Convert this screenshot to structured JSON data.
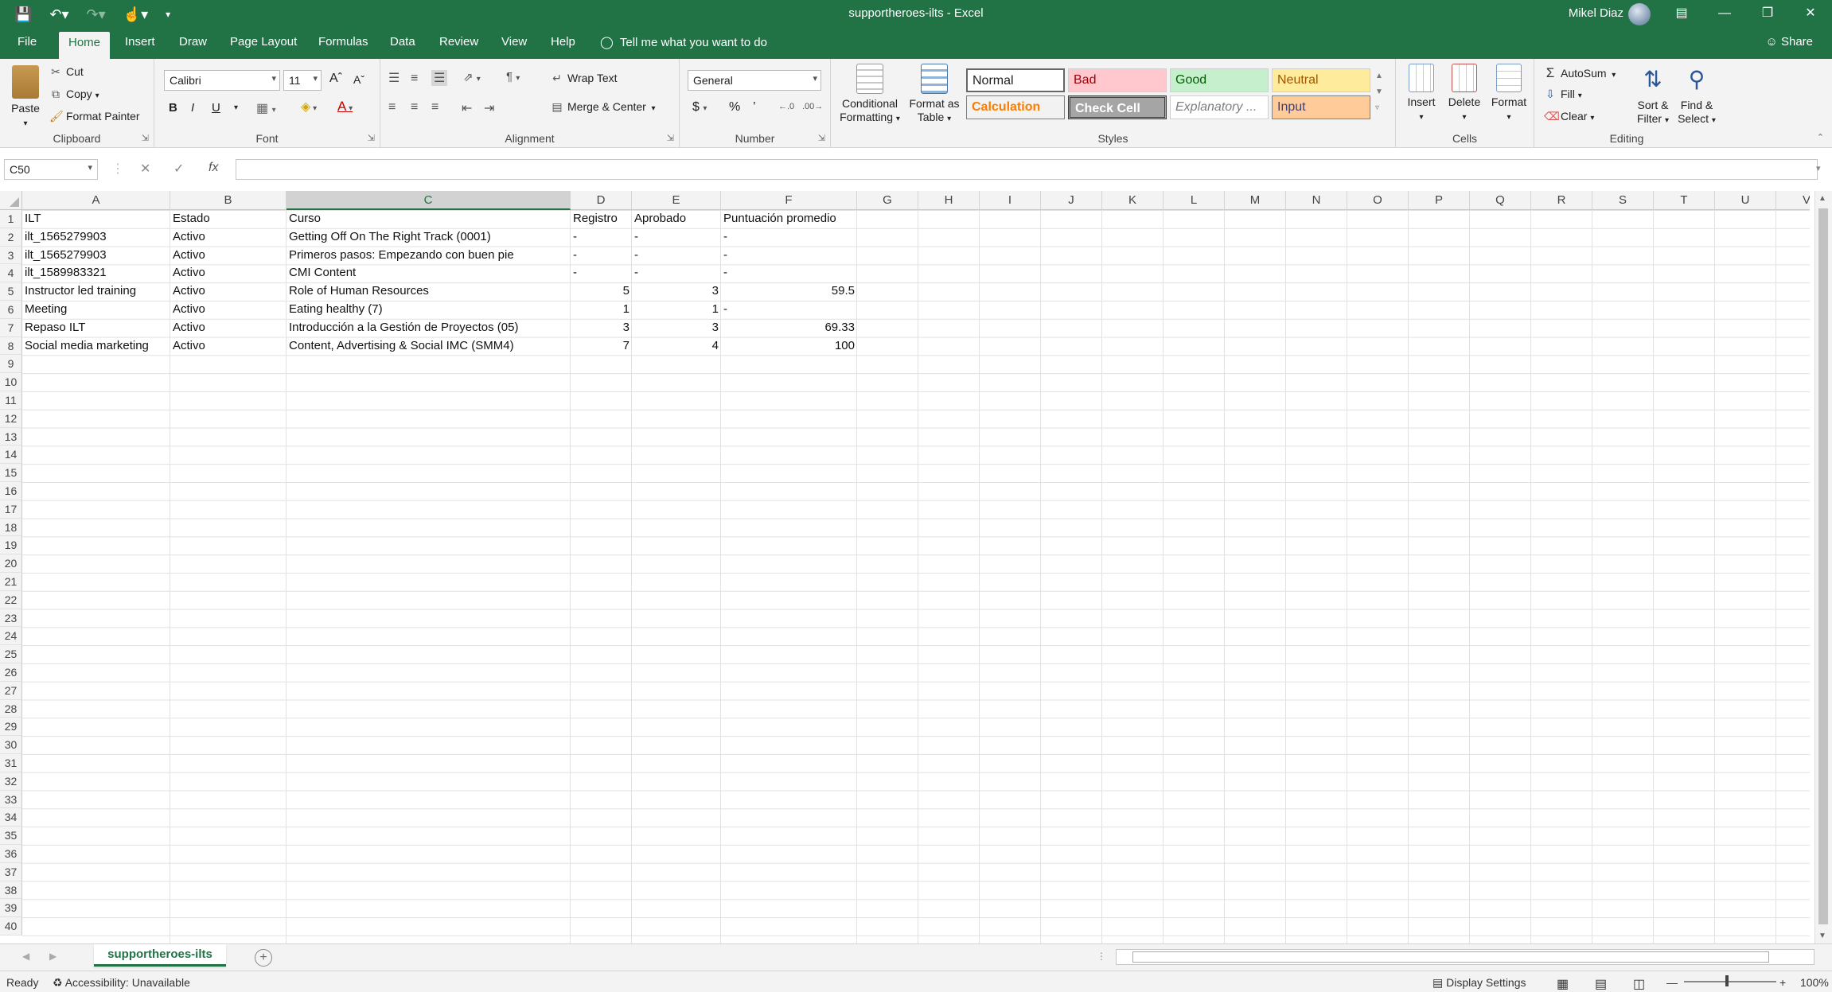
{
  "window": {
    "title": "supportheroes-ilts  -  Excel",
    "user": "Mikel Diaz"
  },
  "tabs": [
    "File",
    "Home",
    "Insert",
    "Draw",
    "Page Layout",
    "Formulas",
    "Data",
    "Review",
    "View",
    "Help"
  ],
  "tell_me": "Tell me what you want to do",
  "share": "Share",
  "ribbon": {
    "clipboard": {
      "label": "Clipboard",
      "paste": "Paste",
      "cut": "Cut",
      "copy": "Copy",
      "format_painter": "Format Painter"
    },
    "font": {
      "label": "Font",
      "name": "Calibri",
      "size": "11",
      "bold": "B",
      "italic": "I",
      "underline": "U"
    },
    "alignment": {
      "label": "Alignment",
      "wrap_text": "Wrap Text",
      "merge_center": "Merge & Center"
    },
    "number": {
      "label": "Number",
      "format": "General",
      "currency": "$",
      "percent": "%",
      "comma": "’"
    },
    "styles": {
      "label": "Styles",
      "conditional": [
        "Conditional",
        "Formatting"
      ],
      "format_table": [
        "Format as",
        "Table"
      ],
      "normal": "Normal",
      "bad": "Bad",
      "good": "Good",
      "neutral": "Neutral",
      "calculation": "Calculation",
      "check_cell": "Check Cell",
      "explanatory": "Explanatory ...",
      "input": "Input"
    },
    "cells": {
      "label": "Cells",
      "insert": "Insert",
      "delete": "Delete",
      "format": "Format"
    },
    "editing": {
      "label": "Editing",
      "autosum": "AutoSum",
      "fill": "Fill",
      "clear": "Clear",
      "sort": [
        "Sort &",
        "Filter"
      ],
      "find": [
        "Find &",
        "Select"
      ]
    }
  },
  "formula_bar": {
    "name_box": "C50",
    "formula": ""
  },
  "columns": [
    "A",
    "B",
    "C",
    "D",
    "E",
    "F",
    "G",
    "H",
    "I",
    "J",
    "K",
    "L",
    "M",
    "N",
    "O",
    "P",
    "Q",
    "R",
    "S",
    "T",
    "U",
    "V"
  ],
  "rows": [
    "1",
    "2",
    "3",
    "4",
    "5",
    "6",
    "7",
    "8",
    "9",
    "10",
    "11",
    "12",
    "13",
    "14",
    "15",
    "16",
    "17",
    "18",
    "19",
    "20",
    "21",
    "22",
    "23",
    "24",
    "25",
    "26",
    "27",
    "28",
    "29",
    "30",
    "31",
    "32",
    "33",
    "34",
    "35",
    "36",
    "37",
    "38",
    "39",
    "40"
  ],
  "table": {
    "headers": [
      "ILT",
      "Estado",
      "Curso",
      "Registro",
      "Aprobado",
      "Puntuación promedio"
    ],
    "rows": [
      [
        "ilt_1565279903",
        "Activo",
        "Getting Off On The Right Track (0001)",
        "-",
        "-",
        "-"
      ],
      [
        "ilt_1565279903",
        "Activo",
        "Primeros pasos: Empezando con buen pie",
        "-",
        "-",
        "-"
      ],
      [
        "ilt_1589983321",
        "Activo",
        "CMI Content",
        "-",
        "-",
        "-"
      ],
      [
        "Instructor led training",
        "Activo",
        "Role of Human Resources",
        "5",
        "3",
        "59.5"
      ],
      [
        "Meeting",
        "Activo",
        "Eating healthy (7)",
        "1",
        "1",
        "-"
      ],
      [
        "Repaso ILT",
        "Activo",
        "Introducción a la Gestión de Proyectos (05)",
        "3",
        "3",
        "69.33"
      ],
      [
        "Social media marketing",
        "Activo",
        "Content, Advertising & Social IMC (SMM4)",
        "7",
        "4",
        "100"
      ]
    ]
  },
  "sheet_tab": "supportheroes-ilts",
  "status": {
    "ready": "Ready",
    "accessibility": "Accessibility: Unavailable",
    "display_settings": "Display Settings",
    "zoom": "100%"
  }
}
